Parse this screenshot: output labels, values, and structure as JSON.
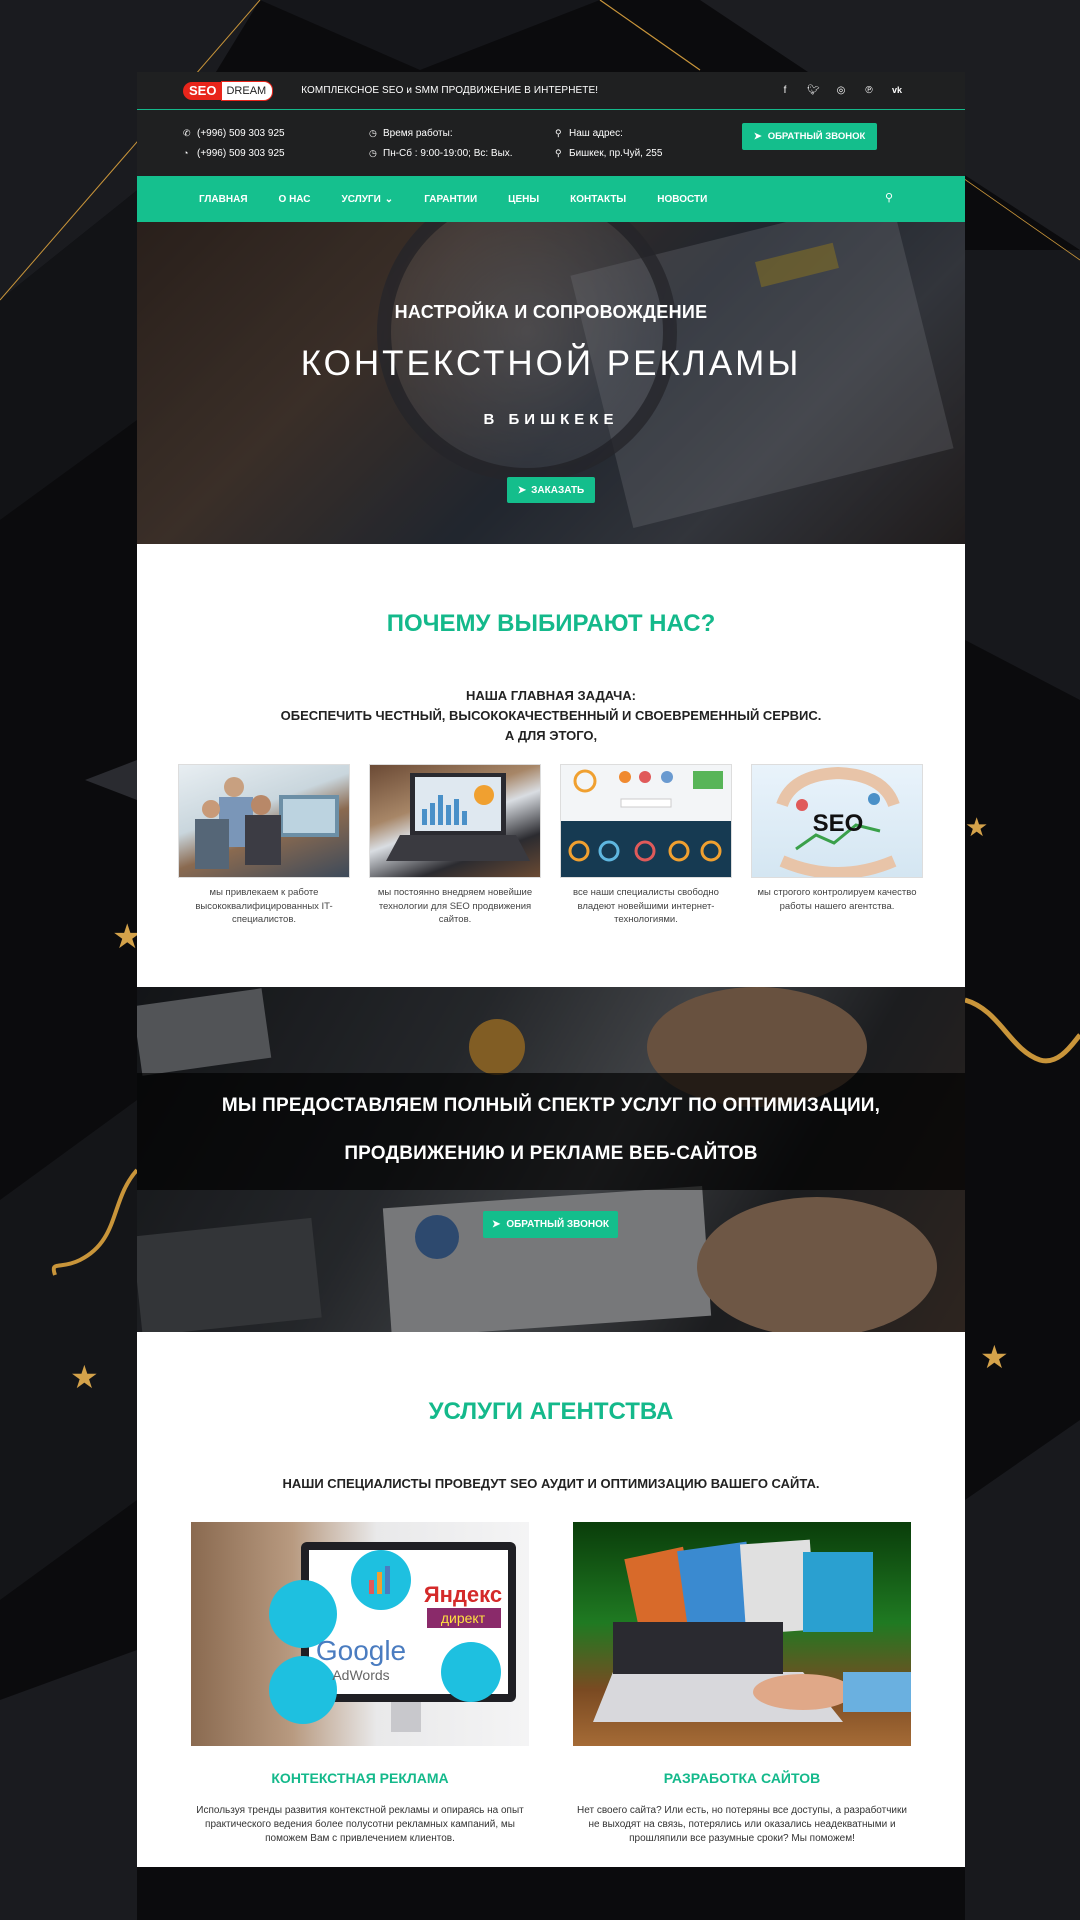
{
  "topbar": {
    "logo_left": "SEO",
    "logo_right": "DREAM",
    "tagline": "КОМПЛЕКСНОЕ SEO и SMM ПРОДВИЖЕНИЕ В ИНТЕРНЕТЕ!",
    "socials": [
      "facebook-icon",
      "twitter-icon",
      "instagram-icon",
      "pinterest-icon",
      "vk-icon"
    ]
  },
  "contacts": {
    "phone1": "(+996) 509 303 925",
    "phone2": "(+996) 509 303 925",
    "hours_label": "Время работы:",
    "hours_value": "Пн-Сб : 9:00-19:00; Вс: Вых.",
    "address_label": "Наш адрес:",
    "address_value": "Бишкек, пр.Чуй, 255",
    "callback_label": "ОБРАТНЫЙ ЗВОНОК"
  },
  "nav": {
    "items": [
      "ГЛАВНАЯ",
      "О НАС",
      "УСЛУГИ",
      "ГАРАНТИИ",
      "ЦЕНЫ",
      "КОНТАКТЫ",
      "НОВОСТИ"
    ]
  },
  "hero": {
    "subtitle": "НАСТРОЙКА И СОПРОВОЖДЕНИЕ",
    "title": "КОНТЕКСТНОЙ РЕКЛАМЫ",
    "city": "В БИШКЕКЕ",
    "order_label": "ЗАКАЗАТЬ"
  },
  "why": {
    "title": "ПОЧЕМУ ВЫБИРАЮТ НАС?",
    "lead1": "НАША ГЛАВНАЯ ЗАДАЧА:",
    "lead2": "ОБЕСПЕЧИТЬ ЧЕСТНЫЙ, ВЫСОКОКАЧЕСТВЕННЫЙ И СВОЕВРЕМЕННЫЙ СЕРВИС.",
    "lead3": "А ДЛЯ ЭТОГО,",
    "cards": [
      {
        "caption": "мы привлекаем к работе высококвалифицированных IT-специалистов."
      },
      {
        "caption": "мы постоянно внедряем новейшие технологии для SEO продвижения сайтов."
      },
      {
        "caption": "все наши специалисты свободно владеют новейшими интернет-технологиями."
      },
      {
        "caption": "мы строгого контролируем качество работы нашего агентства."
      }
    ]
  },
  "banner": {
    "line1": "МЫ ПРЕДОСТАВЛЯЕМ ПОЛНЫЙ СПЕКТР УСЛУГ ПО ОПТИМИЗАЦИИ,",
    "line2": "ПРОДВИЖЕНИЮ И РЕКЛАМЕ ВЕБ-САЙТОВ",
    "button_label": "ОБРАТНЫЙ ЗВОНОК"
  },
  "agency": {
    "title": "УСЛУГИ АГЕНТСТВА",
    "lead": "НАШИ СПЕЦИАЛИСТЫ ПРОВЕДУТ SEO АУДИТ И ОПТИМИЗАЦИЮ ВАШЕГО САЙТА.",
    "services": [
      {
        "title": "КОНТЕКСТНАЯ РЕКЛАМА",
        "text": "Используя тренды развития контекстной рекламы и опираясь на опыт практического ведения более полусотни рекламных кампаний, мы поможем Вам с привлечением клиентов."
      },
      {
        "title": "РАЗРАБОТКА САЙТОВ",
        "text": "Нет своего сайта? Или есть, но потеряны все доступы, а разработчики не выходят на связь, потерялись или оказались неадекватными и прошляпили все разумные сроки? Мы поможем!"
      }
    ],
    "ppc_image_texts": {
      "yandex": "Яндекс",
      "direct": "директ",
      "google": "Google",
      "adwords": "AdWords"
    },
    "seo_badge": "SEO"
  },
  "colors": {
    "accent": "#14be8c",
    "dark_bar": "#1f2021",
    "background": "#0d0d0f",
    "gold": "#c9953a"
  }
}
